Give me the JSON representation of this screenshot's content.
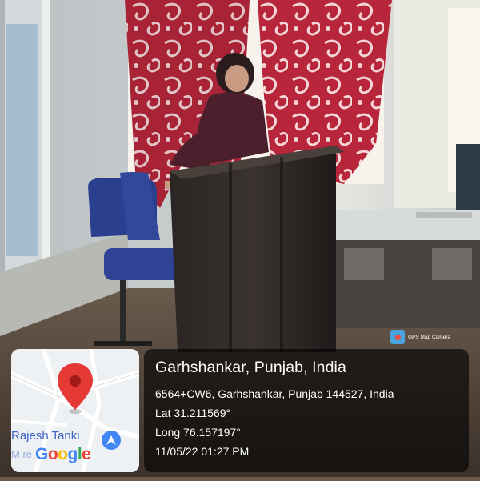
{
  "stamp": {
    "app_badge": "GPS Map Camera",
    "location_title": "Garhshankar, Punjab, India",
    "address": "6564+CW6, Garhshankar, Punjab 144527, India",
    "lat": "Lat 31.211569°",
    "long": "Long 76.157197°",
    "datetime": "11/05/22 01:27 PM"
  },
  "map": {
    "place_label": "Rajesh Tanki",
    "place_label_secondary": "M   re",
    "logo": {
      "g1": "G",
      "o1": "o",
      "o2": "o",
      "g2": "g",
      "l": "l",
      "e": "e"
    },
    "pin_color": "#e53935",
    "place_icon_color": "#4285f4"
  }
}
